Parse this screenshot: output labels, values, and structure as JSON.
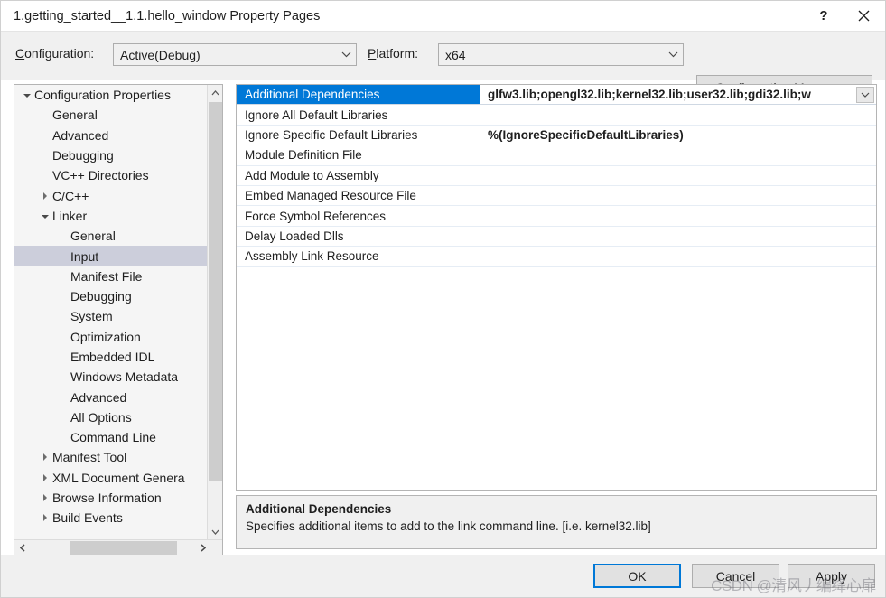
{
  "window": {
    "title": "1.getting_started__1.1.hello_window Property Pages",
    "help_icon": "?",
    "close_icon": "close-icon"
  },
  "config_bar": {
    "configuration_label": "Configuration:",
    "configuration_value": "Active(Debug)",
    "platform_label": "Platform:",
    "platform_value": "x64",
    "configuration_manager_label": "Configuration Manager..."
  },
  "tree": {
    "selected": "Input",
    "nodes": [
      {
        "label": "Configuration Properties",
        "indent": 0,
        "expander": "open"
      },
      {
        "label": "General",
        "indent": 1,
        "expander": "none"
      },
      {
        "label": "Advanced",
        "indent": 1,
        "expander": "none"
      },
      {
        "label": "Debugging",
        "indent": 1,
        "expander": "none"
      },
      {
        "label": "VC++ Directories",
        "indent": 1,
        "expander": "none"
      },
      {
        "label": "C/C++",
        "indent": 1,
        "expander": "closed"
      },
      {
        "label": "Linker",
        "indent": 1,
        "expander": "open"
      },
      {
        "label": "General",
        "indent": 2,
        "expander": "none"
      },
      {
        "label": "Input",
        "indent": 2,
        "expander": "none",
        "selected": true
      },
      {
        "label": "Manifest File",
        "indent": 2,
        "expander": "none"
      },
      {
        "label": "Debugging",
        "indent": 2,
        "expander": "none"
      },
      {
        "label": "System",
        "indent": 2,
        "expander": "none"
      },
      {
        "label": "Optimization",
        "indent": 2,
        "expander": "none"
      },
      {
        "label": "Embedded IDL",
        "indent": 2,
        "expander": "none"
      },
      {
        "label": "Windows Metadata",
        "indent": 2,
        "expander": "none"
      },
      {
        "label": "Advanced",
        "indent": 2,
        "expander": "none"
      },
      {
        "label": "All Options",
        "indent": 2,
        "expander": "none"
      },
      {
        "label": "Command Line",
        "indent": 2,
        "expander": "none"
      },
      {
        "label": "Manifest Tool",
        "indent": 1,
        "expander": "closed"
      },
      {
        "label": "XML Document Genera",
        "indent": 1,
        "expander": "closed"
      },
      {
        "label": "Browse Information",
        "indent": 1,
        "expander": "closed"
      },
      {
        "label": "Build Events",
        "indent": 1,
        "expander": "closed"
      }
    ]
  },
  "grid": {
    "rows": [
      {
        "name": "Additional Dependencies",
        "value": "glfw3.lib;opengl32.lib;kernel32.lib;user32.lib;gdi32.lib;w",
        "active": true,
        "has_dropdown": true
      },
      {
        "name": "Ignore All Default Libraries",
        "value": ""
      },
      {
        "name": "Ignore Specific Default Libraries",
        "value": "%(IgnoreSpecificDefaultLibraries)"
      },
      {
        "name": "Module Definition File",
        "value": ""
      },
      {
        "name": "Add Module to Assembly",
        "value": ""
      },
      {
        "name": "Embed Managed Resource File",
        "value": ""
      },
      {
        "name": "Force Symbol References",
        "value": ""
      },
      {
        "name": "Delay Loaded Dlls",
        "value": ""
      },
      {
        "name": "Assembly Link Resource",
        "value": ""
      }
    ]
  },
  "description": {
    "title": "Additional Dependencies",
    "body": "Specifies additional items to add to the link command line. [i.e. kernel32.lib]"
  },
  "footer": {
    "ok_label": "OK",
    "cancel_label": "Cancel",
    "apply_label": "Apply"
  },
  "watermark": {
    "text": "CSDN @清风丿编绛心扉"
  },
  "colors": {
    "accent": "#0078D7",
    "tree_selection": "#CCCEDB",
    "dialog_bg": "#F0F0F0"
  }
}
